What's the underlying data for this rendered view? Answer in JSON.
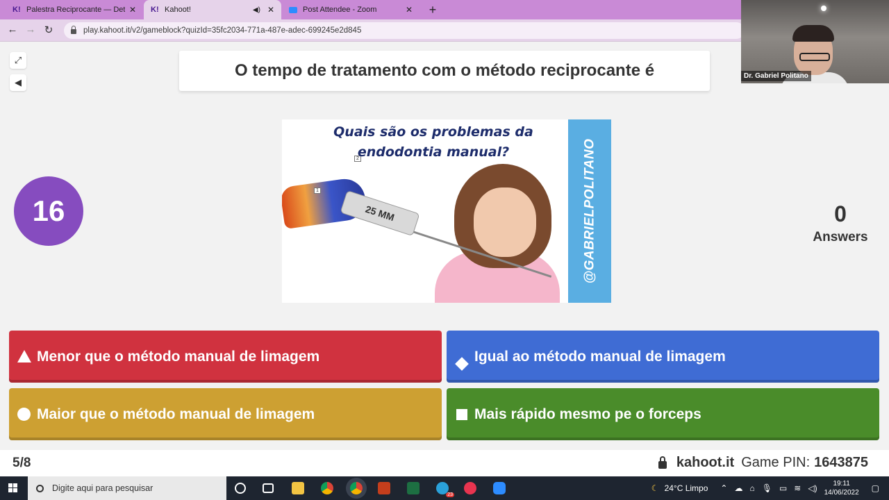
{
  "browser": {
    "tabs": [
      {
        "label": "Palestra Reciprocante — Detalhe",
        "favicon": "kahoot-icon",
        "close": "✕"
      },
      {
        "label": "Kahoot!",
        "favicon": "kahoot-icon",
        "close": "✕",
        "active": true
      },
      {
        "label": "Post Attendee - Zoom",
        "favicon": "zoom-icon",
        "close": "✕"
      }
    ],
    "url": "play.kahoot.it/v2/gameblock?quizId=35fc2034-771a-487e-adec-699245e2d845"
  },
  "video": {
    "participant_name": "Dr. Gabriel Politano"
  },
  "question": {
    "text": "O tempo de tratamento com o método reciprocante é"
  },
  "timer": {
    "seconds": "16"
  },
  "answers_count": {
    "number": "0",
    "label": "Answers"
  },
  "media": {
    "caption_line1": "Quais são os problemas da",
    "caption_line2": "endodontia manual?",
    "side_text": "@GABRIELPOLITANO",
    "file_label": "25 MM",
    "tag1": "1",
    "tag2": "2"
  },
  "answers": [
    {
      "text": "Menor que o método manual de limagem",
      "shape": "triangle-icon",
      "color": "#d0323f"
    },
    {
      "text": "Igual ao método manual de limagem",
      "shape": "diamond-icon",
      "color": "#3f6cd4"
    },
    {
      "text": "Maior que o método manual de limagem",
      "shape": "circle-icon",
      "color": "#cda032"
    },
    {
      "text": "Mais rápido mesmo pe o forceps",
      "shape": "square-icon",
      "color": "#4a8c2a"
    }
  ],
  "footer": {
    "progress": "5/8",
    "brand": "kahoot.it",
    "pin_label": "Game PIN:",
    "pin": "1643875"
  },
  "taskbar": {
    "search_placeholder": "Digite aqui para pesquisar",
    "weather": "24°C  Limpo",
    "time": "19:11",
    "date": "14/06/2022",
    "telegram_badge": "23"
  }
}
